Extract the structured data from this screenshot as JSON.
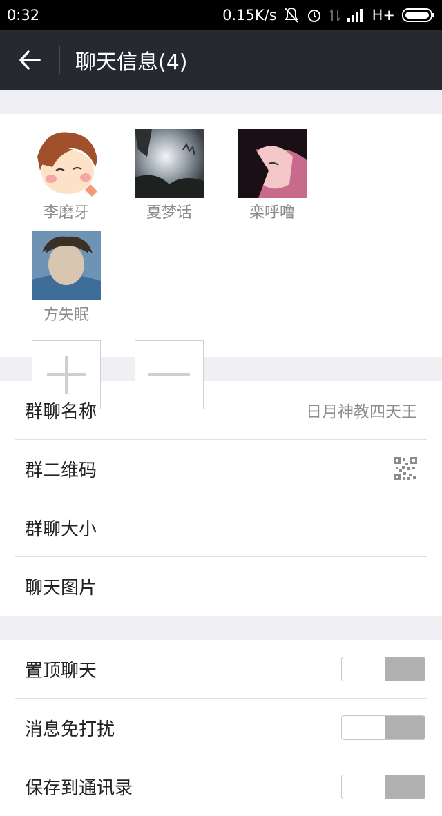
{
  "status_bar": {
    "time": "0:32",
    "net_speed": "0.15K/s",
    "network": "H+"
  },
  "header": {
    "title": "聊天信息(4)"
  },
  "members": [
    {
      "name": "李磨牙"
    },
    {
      "name": "夏梦话"
    },
    {
      "name": "栾呼噜"
    },
    {
      "name": "方失眠"
    }
  ],
  "settings_group1": {
    "group_name_label": "群聊名称",
    "group_name_value": "日月神教四天王",
    "qr_label": "群二维码",
    "size_label": "群聊大小",
    "images_label": "聊天图片"
  },
  "settings_group2": {
    "pin_label": "置顶聊天",
    "mute_label": "消息免打扰",
    "save_label": "保存到通讯录"
  },
  "toggles": {
    "pin": false,
    "mute": false,
    "save": false
  },
  "colors": {
    "header_bg": "#262a30",
    "status_bg": "#000000",
    "page_bg": "#efeff4"
  }
}
